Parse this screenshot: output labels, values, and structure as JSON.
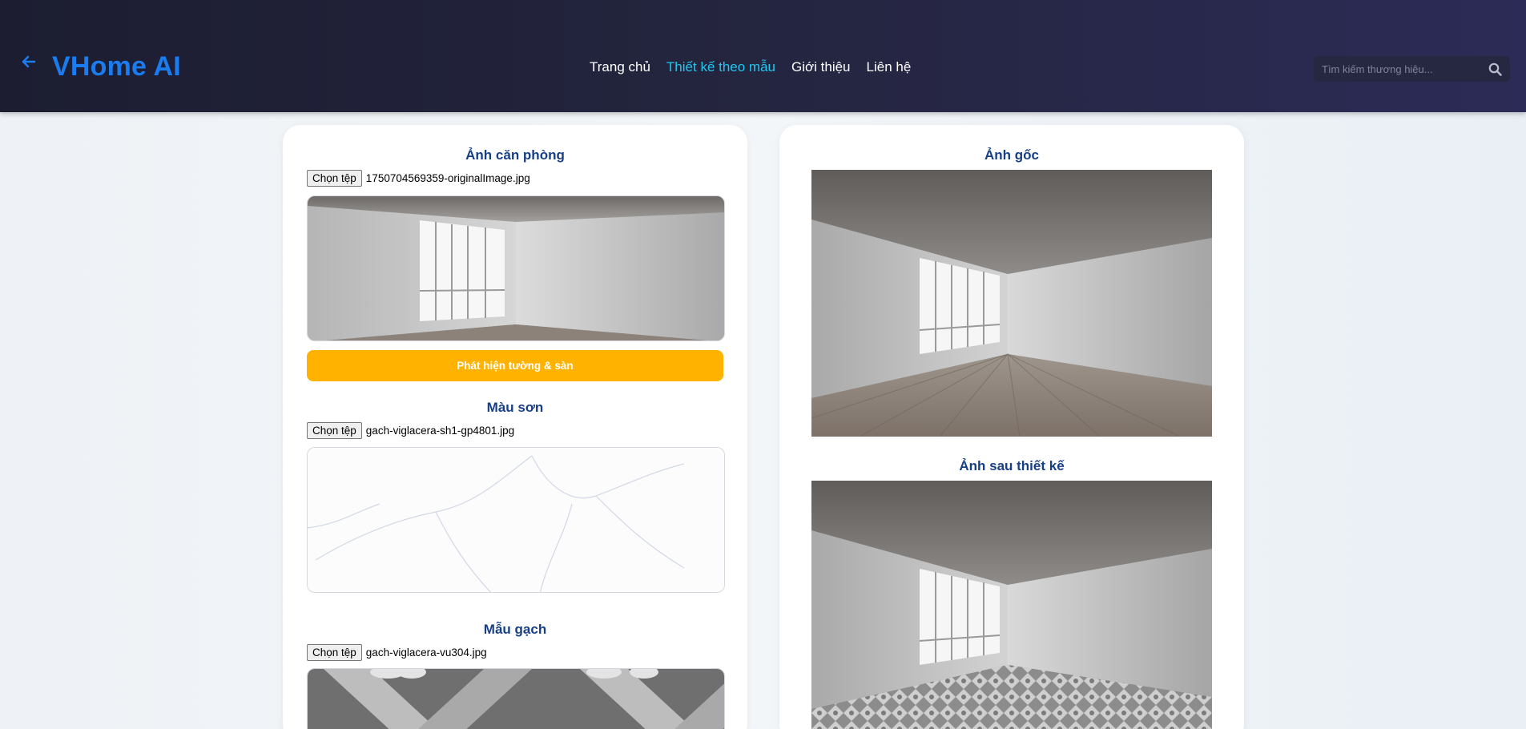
{
  "header": {
    "brand": "VHome AI",
    "back_icon": "arrow-left-icon",
    "nav": [
      {
        "label": "Trang chủ",
        "active": false
      },
      {
        "label": "Thiết kế theo mẫu",
        "active": true
      },
      {
        "label": "Giới thiệu",
        "active": false
      },
      {
        "label": "Liên hệ",
        "active": false
      }
    ],
    "search": {
      "placeholder": "Tìm kiếm thương hiệu...",
      "icon": "search-icon"
    }
  },
  "left_panel": {
    "room": {
      "title": "Ảnh căn phòng",
      "file_button": "Chọn tệp",
      "file_name": "1750704569359-originalImage.jpg"
    },
    "detect_button": "Phát hiện tường & sàn",
    "paint": {
      "title": "Màu sơn",
      "file_button": "Chọn tệp",
      "file_name": "gach-viglacera-sh1-gp4801.jpg"
    },
    "tile": {
      "title": "Mẫu gạch",
      "file_button": "Chọn tệp",
      "file_name": "gach-viglacera-vu304.jpg"
    }
  },
  "right_panel": {
    "original_title": "Ảnh gốc",
    "result_title": "Ảnh sau thiết kế"
  },
  "colors": {
    "accent": "#1a7cf0",
    "nav_active": "#22c7f0",
    "section_title": "#163f86",
    "detect_button": "#ffb300"
  }
}
